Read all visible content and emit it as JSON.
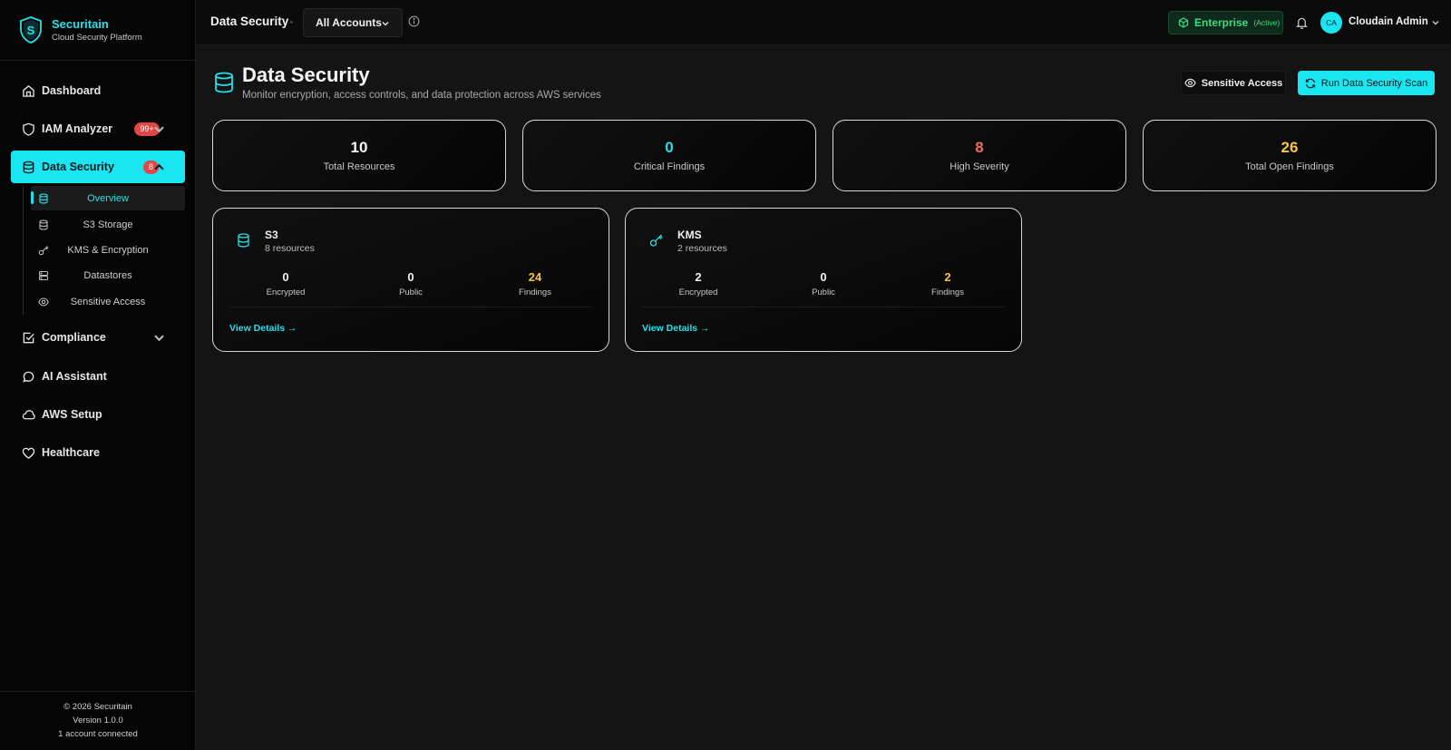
{
  "brand": {
    "name": "Securitain",
    "subtitle": "Cloud Security Platform"
  },
  "sidebar": {
    "items": [
      {
        "label": "Dashboard",
        "icon": "home-icon"
      },
      {
        "label": "IAM Analyzer",
        "icon": "shield-icon",
        "badge": "99+"
      },
      {
        "label": "Data Security",
        "icon": "database-icon",
        "badge": "8"
      },
      {
        "label": "Compliance",
        "icon": "checkbox-icon"
      },
      {
        "label": "AI Assistant",
        "icon": "chat-icon"
      },
      {
        "label": "AWS Setup",
        "icon": "cloud-icon"
      },
      {
        "label": "Healthcare",
        "icon": "heart-icon"
      }
    ],
    "subitems": [
      {
        "label": "Overview",
        "icon": "database-icon"
      },
      {
        "label": "S3 Storage",
        "icon": "database-icon"
      },
      {
        "label": "KMS & Encryption",
        "icon": "key-icon"
      },
      {
        "label": "Datastores",
        "icon": "server-icon"
      },
      {
        "label": "Sensitive Access",
        "icon": "eye-icon"
      }
    ],
    "footer": {
      "copyright": "© 2026 Securitain",
      "version": "Version 1.0.0",
      "accounts": "1 account connected"
    }
  },
  "topbar": {
    "title": "Data Security",
    "account_select": "All Accounts",
    "plan": "Enterprise",
    "plan_status": "(Active)",
    "user_initials": "CA",
    "user_name": "Cloudain Admin"
  },
  "page": {
    "title": "Data Security",
    "subtitle": "Monitor encryption, access controls, and data protection across AWS services",
    "sensitive_button": "Sensitive Access",
    "scan_button": "Run Data Security Scan"
  },
  "stats": [
    {
      "value": "10",
      "label": "Total Resources"
    },
    {
      "value": "0",
      "label": "Critical Findings"
    },
    {
      "value": "8",
      "label": "High Severity"
    },
    {
      "value": "26",
      "label": "Total Open Findings"
    }
  ],
  "services": [
    {
      "name": "S3",
      "count": "8 resources",
      "encrypted": "0",
      "public": "0",
      "findings": "24",
      "link": "View Details →"
    },
    {
      "name": "KMS",
      "count": "2 resources",
      "encrypted": "2",
      "public": "0",
      "findings": "2",
      "link": "View Details →"
    }
  ],
  "metric_labels": {
    "encrypted": "Encrypted",
    "public": "Public",
    "findings": "Findings"
  },
  "colors": {
    "accent": "#19e6f0",
    "critical": "#22e1ea",
    "high": "#f06a5e",
    "open_findings": "#f5c542",
    "plan": "#3ddc84",
    "badge": "#e04848"
  }
}
